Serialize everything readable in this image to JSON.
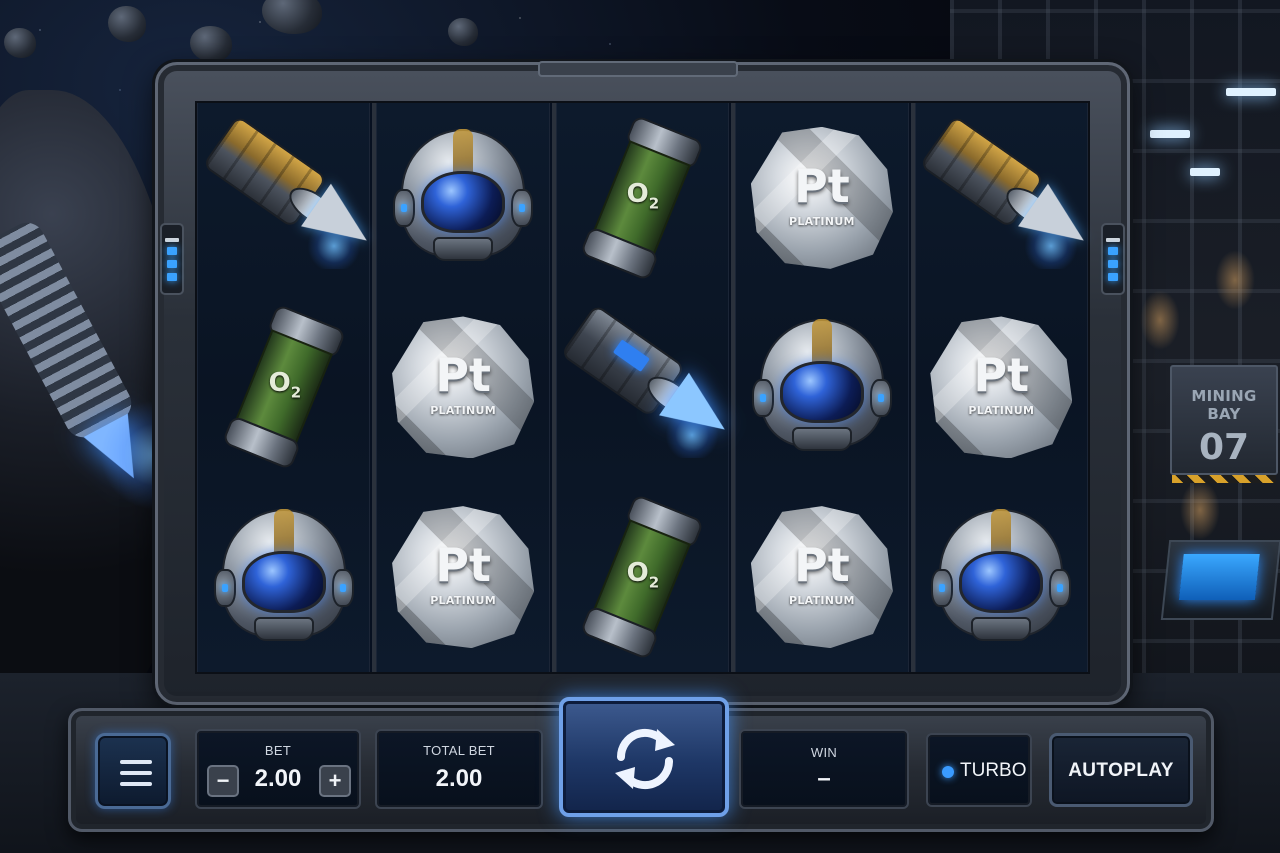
{
  "scene": {
    "sign_line1": "MINING BAY",
    "sign_line2": "07"
  },
  "reels": [
    [
      "drill",
      "o2",
      "helmet"
    ],
    [
      "helmet",
      "platinum",
      "platinum"
    ],
    [
      "o2",
      "drill-blue",
      "o2"
    ],
    [
      "platinum",
      "helmet",
      "platinum"
    ],
    [
      "drill",
      "platinum",
      "helmet"
    ]
  ],
  "symbols": {
    "o2_text": "O",
    "o2_sub": "2",
    "platinum_symbol": "Pt",
    "platinum_name": "PLATINUM"
  },
  "controls": {
    "menu_icon": "hamburger-menu-icon",
    "bet_label": "BET",
    "bet_value": "2.00",
    "bet_minus": "−",
    "bet_plus": "+",
    "total_bet_label": "TOTAL BET",
    "total_bet_value": "2.00",
    "spin_icon": "refresh-arrows-icon",
    "win_label": "WIN",
    "win_value": "–",
    "turbo_label": "TURBO",
    "autoplay_label": "AUTOPLAY"
  },
  "colors": {
    "accent_blue": "#3a9bff",
    "frame_metal": "#4a515d",
    "reel_bg": "#0a1423",
    "gold": "#c69a3a"
  }
}
